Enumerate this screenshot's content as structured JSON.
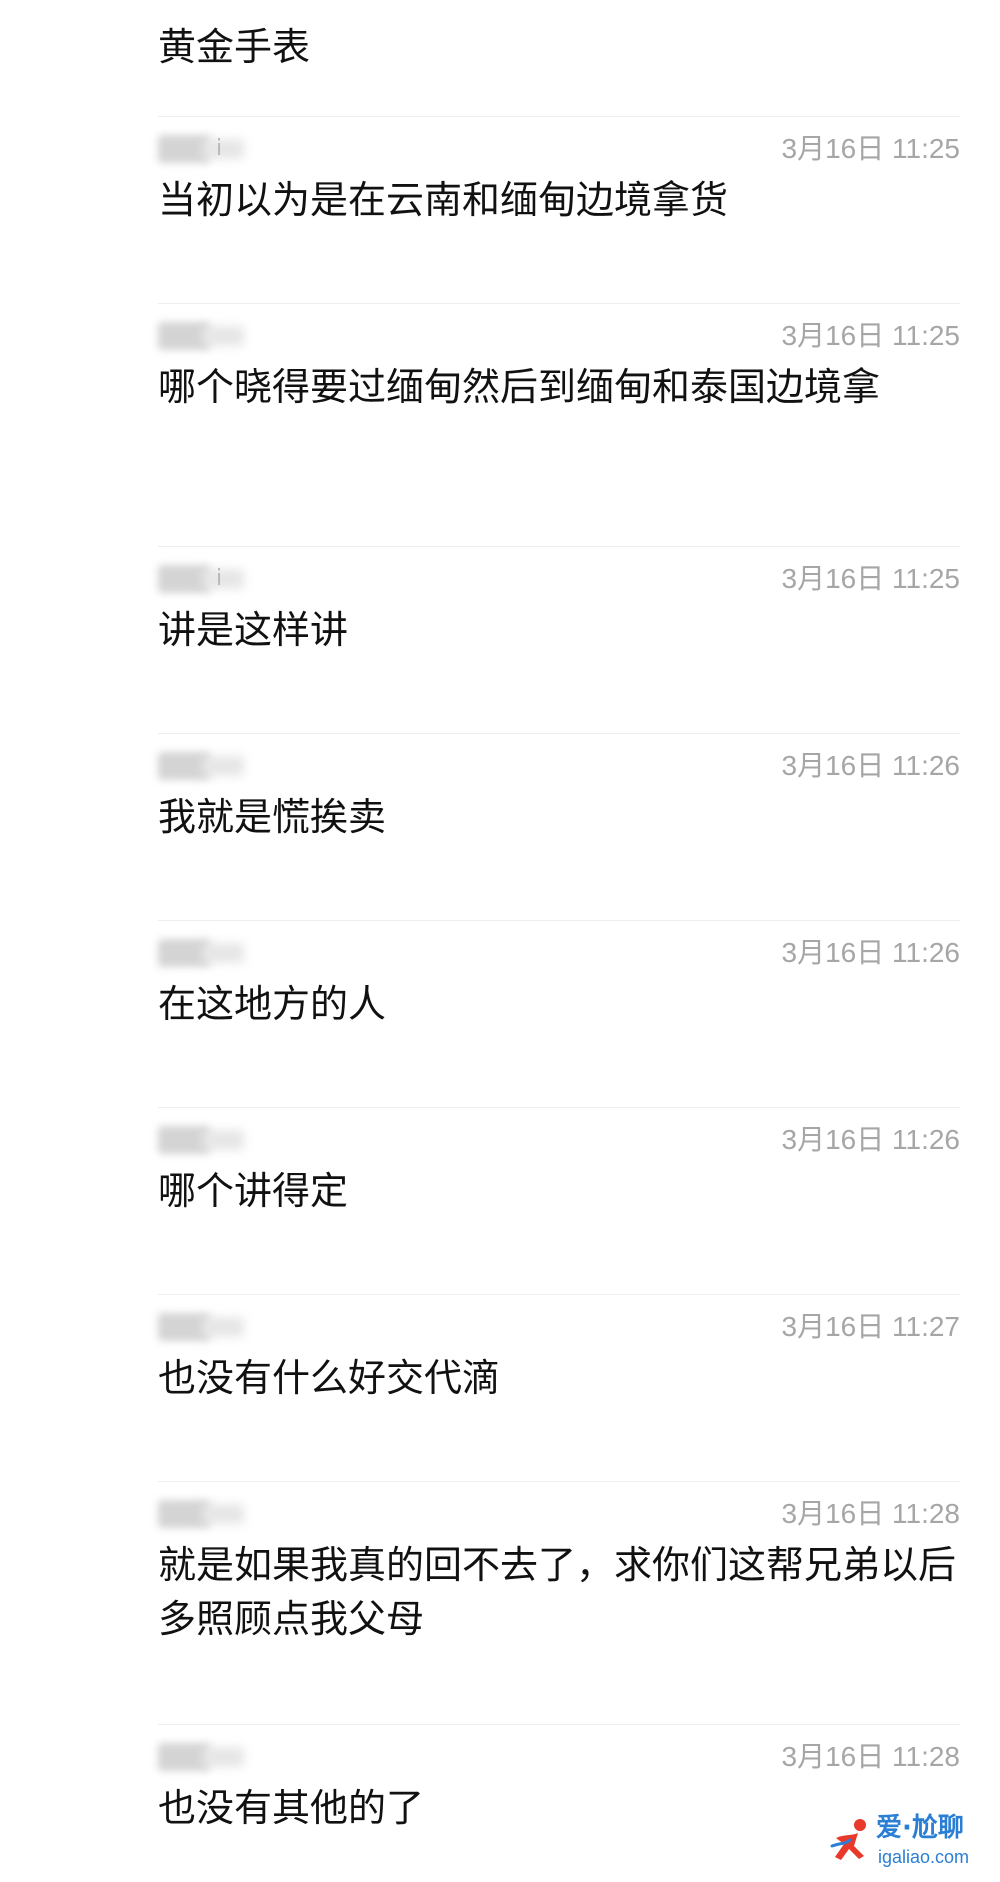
{
  "messages": [
    {
      "text": "黄金手表",
      "time": ""
    },
    {
      "sender_visible": "i",
      "time": "3月16日 11:25",
      "text": "当初以为是在云南和缅甸边境拿货"
    },
    {
      "sender_visible": "",
      "time": "3月16日 11:25",
      "text": "哪个晓得要过缅甸然后到缅甸和泰国边境拿"
    },
    {
      "sender_visible": "i",
      "time": "3月16日 11:25",
      "text": "讲是这样讲"
    },
    {
      "sender_visible": "",
      "time": "3月16日 11:26",
      "text": "我就是慌挨卖"
    },
    {
      "sender_visible": "",
      "time": "3月16日 11:26",
      "text": "在这地方的人"
    },
    {
      "sender_visible": "",
      "time": "3月16日 11:26",
      "text": "哪个讲得定"
    },
    {
      "sender_visible": "",
      "time": "3月16日 11:27",
      "text": "也没有什么好交代滴"
    },
    {
      "sender_visible": "",
      "time": "3月16日 11:28",
      "text": "就是如果我真的回不去了，求你们这帮兄弟以后多照顾点我父母"
    },
    {
      "sender_visible": "",
      "time": "3月16日 11:28",
      "text": "也没有其他的了"
    }
  ],
  "watermark": {
    "title": "爱·尬聊",
    "url": "igaliao.com",
    "logo_icon": "running-figure-icon",
    "color": "#2a7fd4"
  }
}
